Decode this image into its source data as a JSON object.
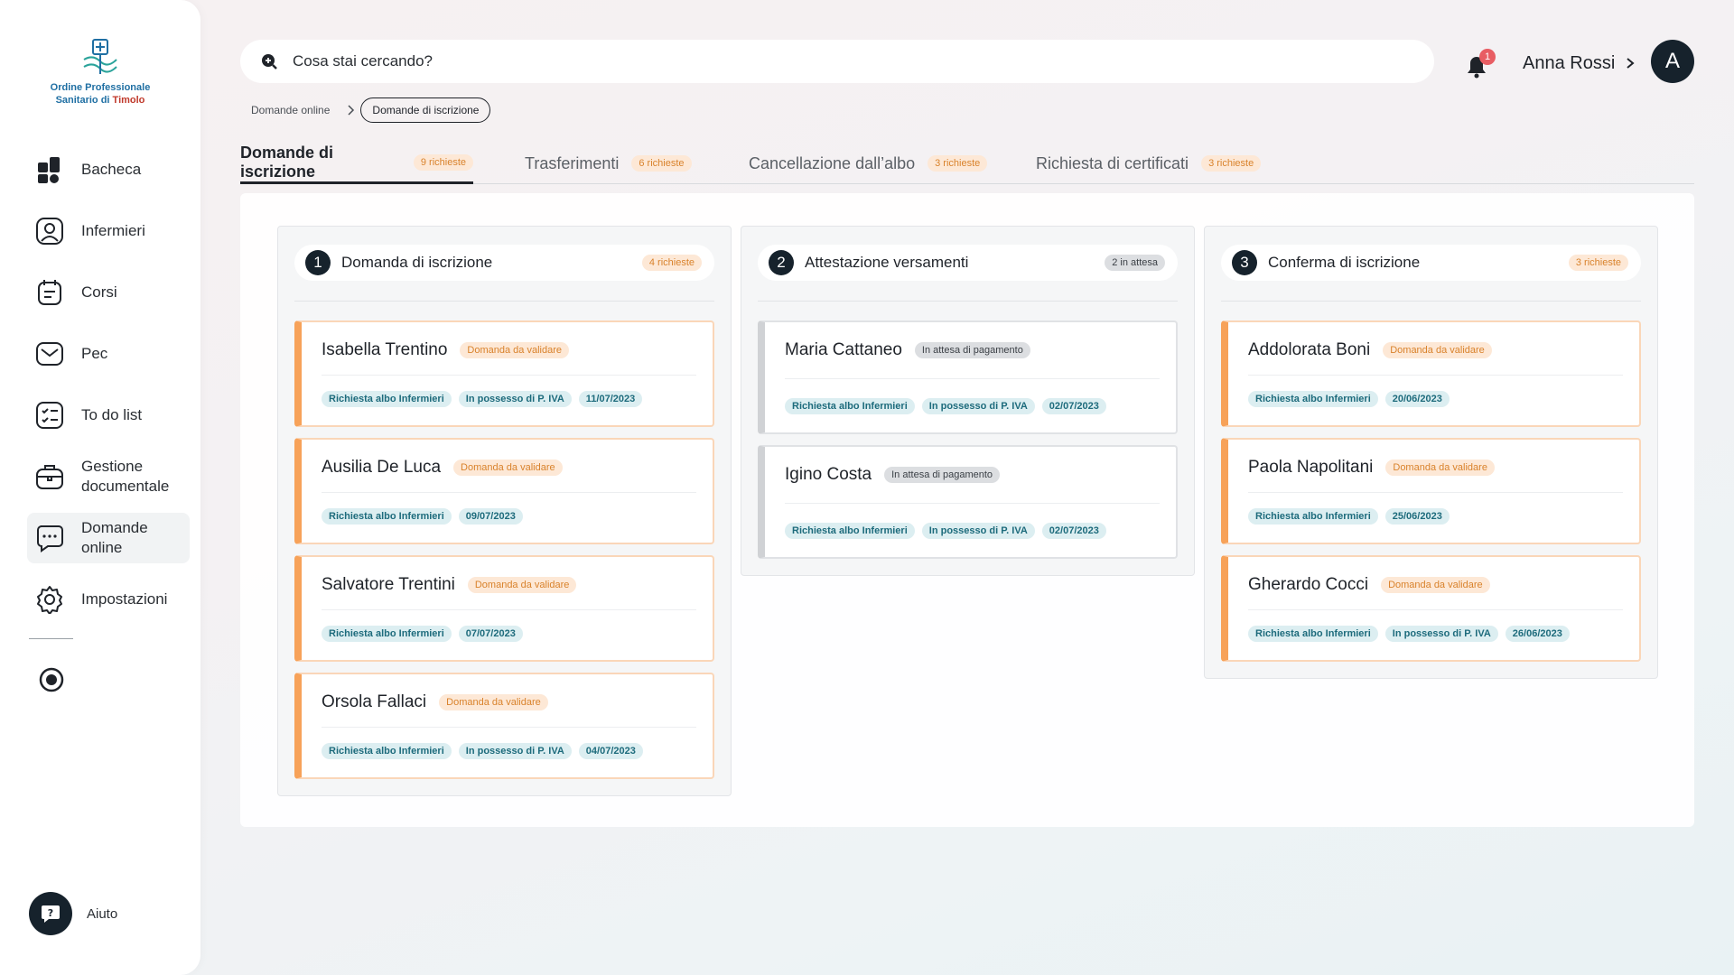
{
  "org": {
    "line1": "Ordine Professionale",
    "line2_prefix": "Sanitario di ",
    "line2_highlight": "Timolo"
  },
  "sidebar": {
    "items": [
      {
        "label": "Bacheca",
        "icon": "dashboard-icon"
      },
      {
        "label": "Infermieri",
        "icon": "user-icon"
      },
      {
        "label": "Corsi",
        "icon": "courses-icon"
      },
      {
        "label": "Pec",
        "icon": "mail-icon"
      },
      {
        "label": "To do list",
        "icon": "checklist-icon"
      },
      {
        "label": "Gestione\ndocumentale",
        "icon": "briefcase-icon"
      },
      {
        "label": "Domande\nonline",
        "icon": "chat-icon"
      },
      {
        "label": "Impostazioni",
        "icon": "gear-icon"
      }
    ],
    "help_label": "Aiuto"
  },
  "search": {
    "placeholder": "Cosa stai cercando?"
  },
  "notifications": {
    "count": "1"
  },
  "user": {
    "name": "Anna Rossi",
    "initial": "A"
  },
  "breadcrumb": {
    "parent": "Domande online",
    "current": "Domande di iscrizione"
  },
  "tabs": [
    {
      "label": "Domande di iscrizione",
      "count": "9 richieste"
    },
    {
      "label": "Trasferimenti",
      "count": "6 richieste"
    },
    {
      "label": "Cancellazione dall’albo",
      "count": "3 richieste"
    },
    {
      "label": "Richiesta di certificati",
      "count": "3 richieste"
    }
  ],
  "columns": [
    {
      "number": "1",
      "title": "Domanda di iscrizione",
      "count": "4 richieste",
      "cards": [
        {
          "name": "Isabella Trentino",
          "status": "Domanda da validare",
          "tags": [
            "Richiesta albo Infermieri",
            "In possesso di P. IVA",
            "11/07/2023"
          ]
        },
        {
          "name": "Ausilia De Luca",
          "status": "Domanda da validare",
          "tags": [
            "Richiesta albo Infermieri",
            "09/07/2023"
          ]
        },
        {
          "name": "Salvatore Trentini",
          "status": "Domanda da validare",
          "tags": [
            "Richiesta albo Infermieri",
            "07/07/2023"
          ]
        },
        {
          "name": "Orsola Fallaci",
          "status": "Domanda da validare",
          "tags": [
            "Richiesta albo Infermieri",
            "In possesso di P. IVA",
            "04/07/2023"
          ]
        }
      ]
    },
    {
      "number": "2",
      "title": "Attestazione versamenti",
      "count": "2 in attesa",
      "cards": [
        {
          "name": "Maria Cattaneo",
          "status": "In attesa di pagamento",
          "tags": [
            "Richiesta albo Infermieri",
            "In possesso di P. IVA",
            "02/07/2023"
          ]
        },
        {
          "name": "Igino Costa",
          "status": "In attesa di pagamento",
          "tags": [
            "Richiesta albo Infermieri",
            "In possesso di P. IVA",
            "02/07/2023"
          ]
        }
      ]
    },
    {
      "number": "3",
      "title": "Conferma di iscrizione",
      "count": "3 richieste",
      "cards": [
        {
          "name": "Addolorata Boni",
          "status": "Domanda da validare",
          "tags": [
            "Richiesta albo Infermieri",
            "20/06/2023"
          ]
        },
        {
          "name": "Paola Napolitani",
          "status": "Domanda da validare",
          "tags": [
            "Richiesta albo Infermieri",
            "25/06/2023"
          ]
        },
        {
          "name": "Gherardo Cocci",
          "status": "Domanda da validare",
          "tags": [
            "Richiesta albo Infermieri",
            "In possesso di P. IVA",
            "26/06/2023"
          ]
        }
      ]
    }
  ],
  "colors": {
    "accent_orange": "#f7a259",
    "dark": "#16222c",
    "tag_teal": "#1d6b7c",
    "badge_red": "#e85d63"
  }
}
